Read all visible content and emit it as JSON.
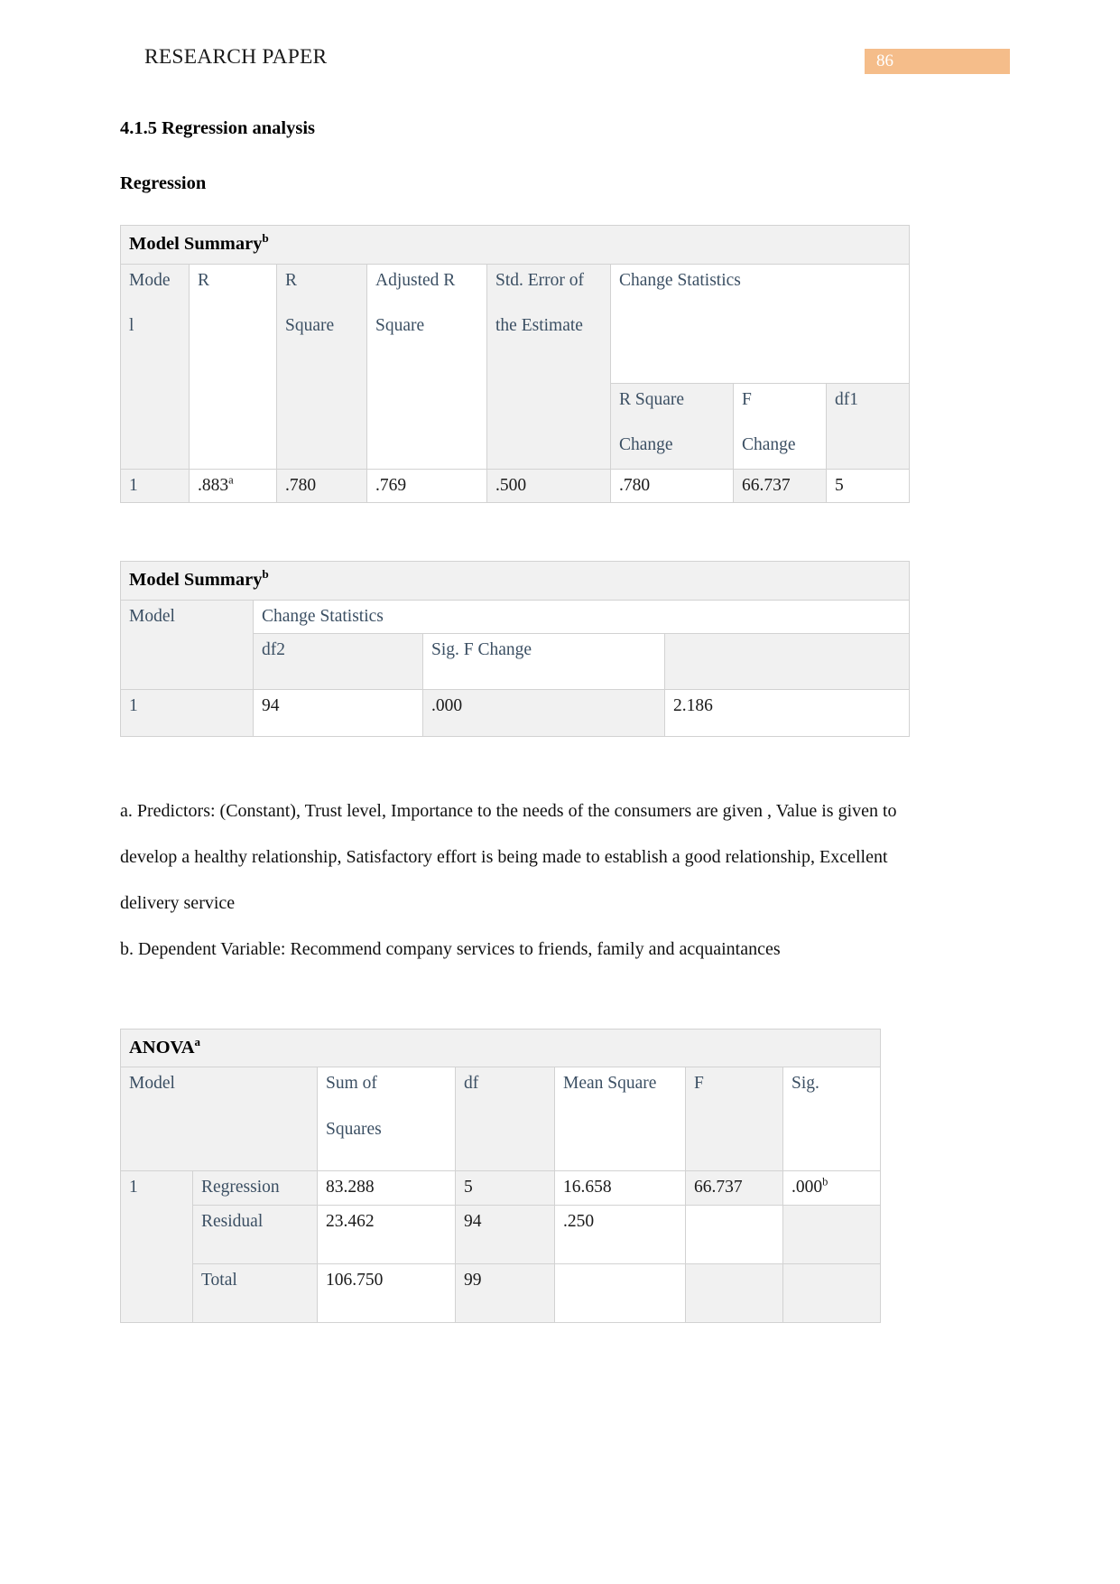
{
  "header": {
    "title": "RESEARCH PAPER",
    "page_number": "86",
    "badge_color": "#f5bd8a"
  },
  "headings": {
    "section": "4.1.5 Regression analysis",
    "subsection": "Regression"
  },
  "model_summary_1": {
    "title": "Model Summary",
    "title_sup": "b",
    "headers": {
      "model": "Mode\nl",
      "model_line1": "Mode",
      "model_line2": "l",
      "r": "R",
      "r_square_line1": "R",
      "r_square_line2": "Square",
      "adjusted_r_line1": "Adjusted R",
      "adjusted_r_line2": "Square",
      "std_error_line1": "Std. Error of",
      "std_error_line2": "the Estimate",
      "change_statistics": "Change Statistics",
      "r_square_change_line1": "R Square",
      "r_square_change_line2": "Change",
      "f_change_line1": "F",
      "f_change_line2": "Change",
      "df1": "df1"
    },
    "row": {
      "model": "1",
      "r": ".883",
      "r_sup": "a",
      "r_square": ".780",
      "adjusted_r_square": ".769",
      "std_error": ".500",
      "r_square_change": ".780",
      "f_change": "66.737",
      "df1": "5"
    }
  },
  "model_summary_2": {
    "title": "Model Summary",
    "title_sup": "b",
    "headers": {
      "model": "Model",
      "change_statistics": "Change Statistics",
      "df2": "df2",
      "sig_f_change": "Sig. F Change",
      "blank": ""
    },
    "row": {
      "model": "1",
      "df2": "94",
      "sig_f_change": ".000",
      "durbin_watson": "2.186"
    }
  },
  "footnotes": {
    "a": "a. Predictors: (Constant), Trust level, Importance to the needs of the consumers are given , Value is given to develop a healthy relationship, Satisfactory effort is being made to establish a good relationship, Excellent delivery service",
    "b": "b. Dependent Variable: Recommend company services to friends, family and acquaintances"
  },
  "anova": {
    "title": "ANOVA",
    "title_sup": "a",
    "headers": {
      "model": "Model",
      "sum_of_squares_line1": "Sum of",
      "sum_of_squares_line2": "Squares",
      "df": "df",
      "mean_square": "Mean Square",
      "f": "F",
      "sig": "Sig."
    },
    "rows": [
      {
        "model": "1",
        "source": "Regression",
        "sum_of_squares": "83.288",
        "df": "5",
        "mean_square": "16.658",
        "f": "66.737",
        "sig": ".000",
        "sig_sup": "b"
      },
      {
        "model": "",
        "source": "Residual",
        "sum_of_squares": "23.462",
        "df": "94",
        "mean_square": ".250",
        "f": "",
        "sig": "",
        "sig_sup": ""
      },
      {
        "model": "",
        "source": "Total",
        "sum_of_squares": "106.750",
        "df": "99",
        "mean_square": "",
        "f": "",
        "sig": "",
        "sig_sup": ""
      }
    ]
  }
}
